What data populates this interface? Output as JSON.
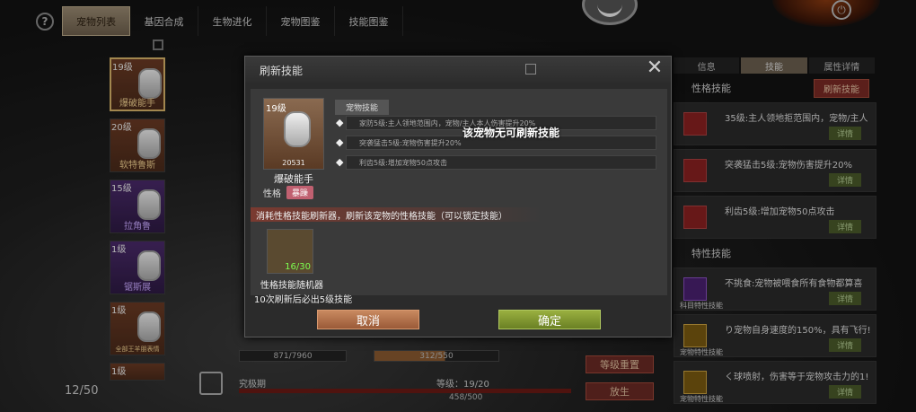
{
  "topnav": {
    "help": "?",
    "tabs": [
      "宠物列表",
      "基因合成",
      "生物进化",
      "宠物图鉴",
      "技能图鉴"
    ]
  },
  "pets": [
    {
      "level": "19级",
      "name": "爆破能手"
    },
    {
      "level": "20级",
      "name": "软特鲁斯"
    },
    {
      "level": "15级",
      "name": "拉角鲁"
    },
    {
      "level": "1级",
      "name": "锯斯展"
    },
    {
      "level": "1级",
      "name": "全部王羊朋表情"
    },
    {
      "level": "1级",
      "name": ""
    }
  ],
  "pet_count": "12/50",
  "right_panel": {
    "tabs": [
      "信息",
      "技能",
      "属性详情"
    ],
    "section1": "性格技能",
    "refresh_btn": "刷新技能",
    "skills": [
      {
        "text": "35级:主人领地拒范围内，宠物/主人",
        "detail": "详情"
      },
      {
        "text": "突袭猛击5级:宠物伤害提升20%",
        "detail": "详情"
      },
      {
        "text": "利齿5级:增加宠物50点攻击",
        "detail": "详情"
      }
    ],
    "section2": "特性技能",
    "traits": [
      {
        "text": "不挑食:宠物被喂食所有食物都算喜",
        "sub": "科目特性技能",
        "detail": "详情"
      },
      {
        "text": "り宠物自身速度的150%，具有飞行!",
        "sub": "宠物特性技能",
        "detail": "详情"
      },
      {
        "text": "く球喷射，伤害等于宠物攻击力的1!",
        "sub": "宠物特性技能",
        "detail": "详情"
      }
    ]
  },
  "left_buttons": {
    "level_reset": "等级重置",
    "release": "放生"
  },
  "stats": {
    "hp": "871/7960",
    "food": "312/550"
  },
  "exp": {
    "label": "究极期",
    "level": "等级：19/20",
    "value": "458/500"
  },
  "dialog": {
    "title": "刷新技能",
    "pet_level": "19级",
    "pet_id": "20531",
    "pet_name": "爆破能手",
    "trait_label": "性格",
    "trait_badge": "暴躁",
    "skill_title": "宠物技能",
    "skills": [
      "家防5级:主人领地范围内，宠物/主人本人伤害提升20%",
      "突袭猛击5级:宠物伤害提升20%",
      "利齿5级:增加宠物50点攻击"
    ],
    "toast": "该宠物无可刷新技能",
    "hint": "消耗性格技能刷新器，刷新该宠物的性格技能（可以锁定技能）",
    "item_count": "16/30",
    "item_name": "性格技能随机器",
    "guarantee": "10次刷新后必出5级技能",
    "cancel": "取消",
    "confirm": "确定"
  }
}
